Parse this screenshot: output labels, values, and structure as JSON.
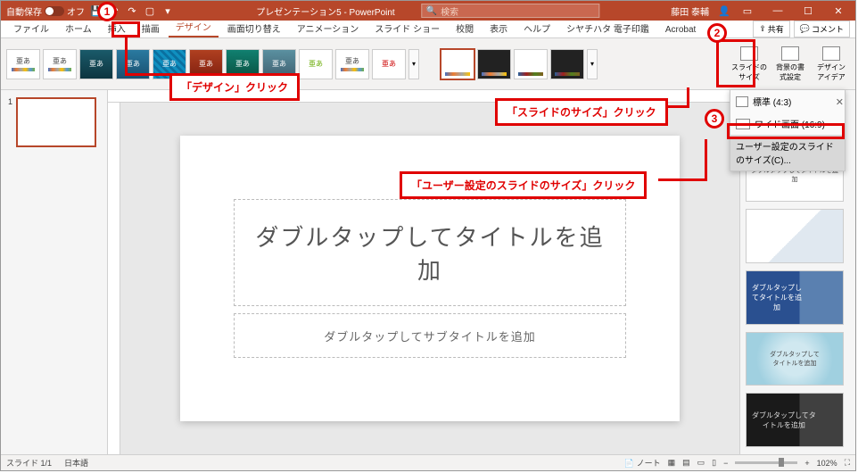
{
  "titlebar": {
    "autosave_label": "自動保存",
    "autosave_state": "オフ",
    "doc_title": "プレゼンテーション5 - PowerPoint",
    "search_placeholder": "検索",
    "user_name": "藤田 泰輔"
  },
  "tabs": {
    "file": "ファイル",
    "home": "ホーム",
    "insert": "挿入",
    "draw": "描画",
    "design": "デザイン",
    "transitions": "画面切り替え",
    "animations": "アニメーション",
    "slideshow": "スライド ショー",
    "review": "校閲",
    "view": "表示",
    "help": "ヘルプ",
    "addin1": "シヤチハタ 電子印鑑",
    "acrobat": "Acrobat"
  },
  "ribbon_right": {
    "share": "共有",
    "comment": "コメント"
  },
  "themes": {
    "sample_text": "亜あ"
  },
  "customize": {
    "slide_size": "スライドの\nサイズ",
    "background": "背景の書\n式設定",
    "design_ideas": "デザイン\nアイデア"
  },
  "size_menu": {
    "standard": "標準 (4:3)",
    "wide": "ワイド画面 (16:9)",
    "custom": "ユーザー設定のスライドのサイズ(C)..."
  },
  "slide": {
    "title_placeholder": "ダブルタップしてタイトルを追加",
    "subtitle_placeholder": "ダブルタップしてサブタイトルを追加"
  },
  "thumbnails": {
    "num1": "1"
  },
  "design_ideas_panel": {
    "idea0": "ダブルタップしてタイトルを追加",
    "idea2": "ダブルタップし\nてタイトルを追\n加",
    "idea3": "ダブルタップして\nタイトルを追加",
    "idea4": "ダブルタップしてタ\nイトルを追加"
  },
  "status": {
    "slide_count": "スライド 1/1",
    "language": "日本語",
    "notes": "ノート",
    "zoom": "102%"
  },
  "callouts": {
    "n1": "1",
    "n2": "2",
    "n3": "3",
    "t1": "「デザイン」クリック",
    "t2": "「スライドのサイズ」クリック",
    "t3": "「ユーザー設定のスライドのサイズ」クリック"
  }
}
